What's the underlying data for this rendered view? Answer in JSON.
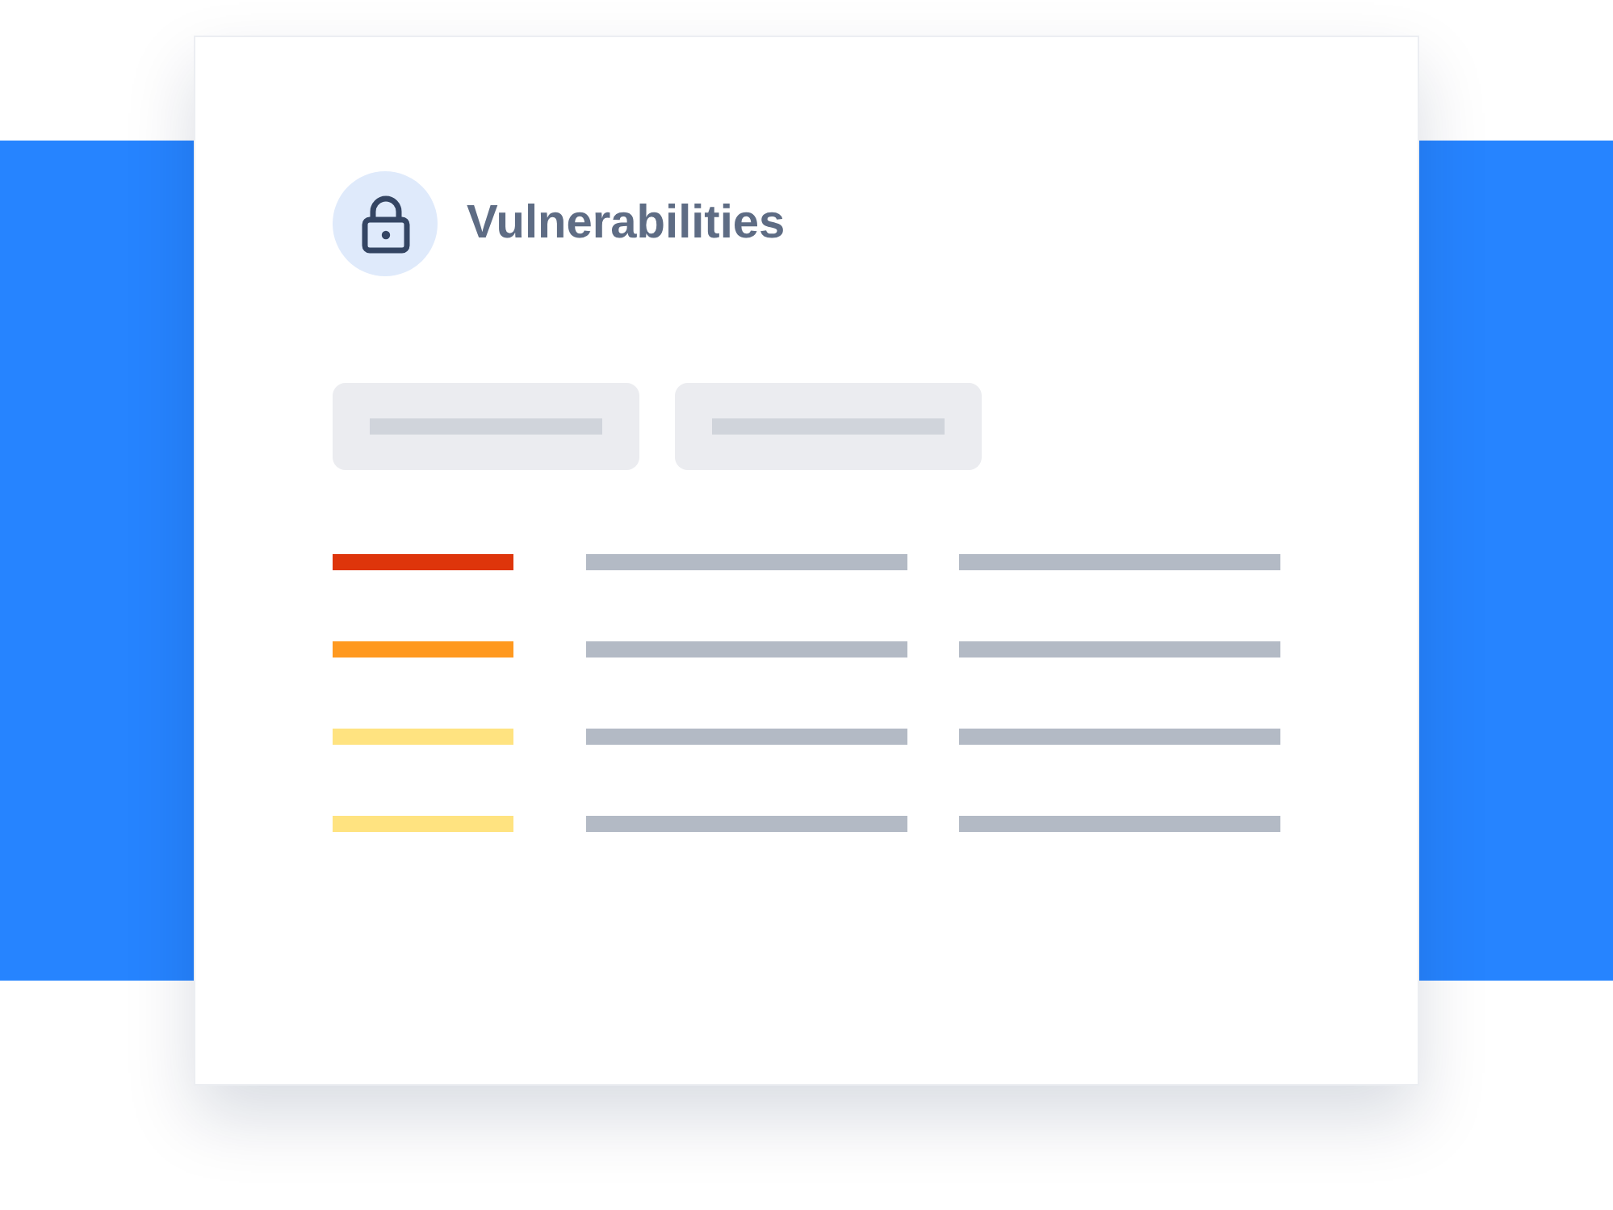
{
  "title": "Vulnerabilities",
  "rows": [
    {
      "color": "#de350b"
    },
    {
      "color": "#ff991f"
    },
    {
      "color": "#ffe380"
    },
    {
      "color": "#ffe380"
    }
  ]
}
